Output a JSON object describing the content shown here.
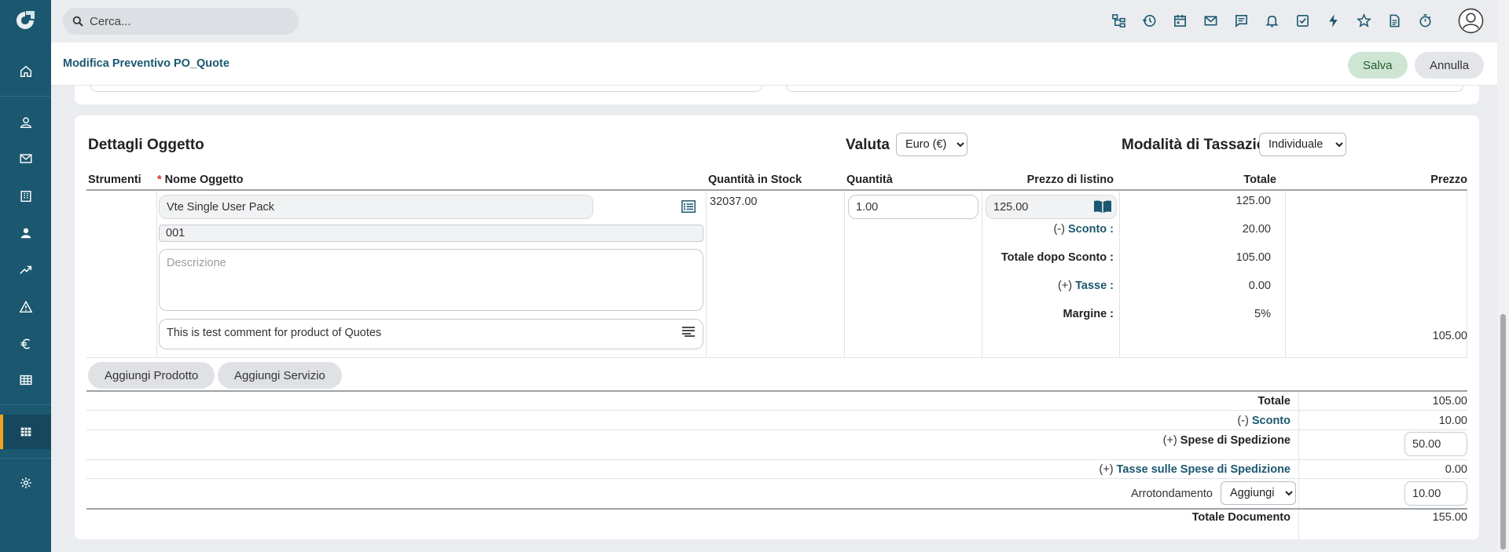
{
  "search": {
    "placeholder": "Cerca..."
  },
  "header": {
    "title": "Modifica Preventivo PO_Quote",
    "save_label": "Salva",
    "cancel_label": "Annulla"
  },
  "section": {
    "title": "Dettagli Oggetto",
    "valuta_label": "Valuta",
    "valuta_value": "Euro (€)",
    "tax_mode_label": "Modalità di Tassazione",
    "tax_mode_value": "Individuale"
  },
  "columns": {
    "tools": "Strumenti",
    "item_name": "Nome Oggetto",
    "stock_qty": "Quantità in Stock",
    "qty": "Quantità",
    "list_price": "Prezzo di listino",
    "total": "Totale",
    "price": "Prezzo"
  },
  "line_item": {
    "name": "Vte Single User Pack",
    "code": "001",
    "description_placeholder": "Descrizione",
    "comment": "This is test comment for product of Quotes",
    "stock": "32037.00",
    "quantity": "1.00",
    "list_price": "125.00",
    "discount_sign": "(-)",
    "discount_label": "Sconto :",
    "total_after_discount_label": "Totale dopo Sconto :",
    "tax_sign": "(+)",
    "tax_label": "Tasse :",
    "margin_label": "Margine :",
    "total": "125.00",
    "discount": "20.00",
    "total_after_discount": "105.00",
    "tax": "0.00",
    "margin": "5%",
    "net_price": "105.00"
  },
  "buttons": {
    "add_product": "Aggiungi Prodotto",
    "add_service": "Aggiungi Servizio"
  },
  "totals": {
    "total_label": "Totale",
    "total_value": "105.00",
    "discount_sign": "(-)",
    "discount_label": "Sconto",
    "discount_value": "10.00",
    "shipping_sign": "(+)",
    "shipping_label": "Spese di Spedizione",
    "shipping_value": "50.00",
    "shipping_tax_sign": "(+)",
    "shipping_tax_label": "Tasse sulle Spese di Spedizione",
    "shipping_tax_value": "0.00",
    "rounding_label": "Arrotondamento",
    "rounding_mode": "Aggiungi",
    "rounding_value": "10.00",
    "grand_total_label": "Totale Documento",
    "grand_total_value": "155.00"
  },
  "colors": {
    "sidebar": "#1b5870",
    "accent": "#f2a31b",
    "link": "#1b5870",
    "save_bg": "#cfe5d3"
  }
}
